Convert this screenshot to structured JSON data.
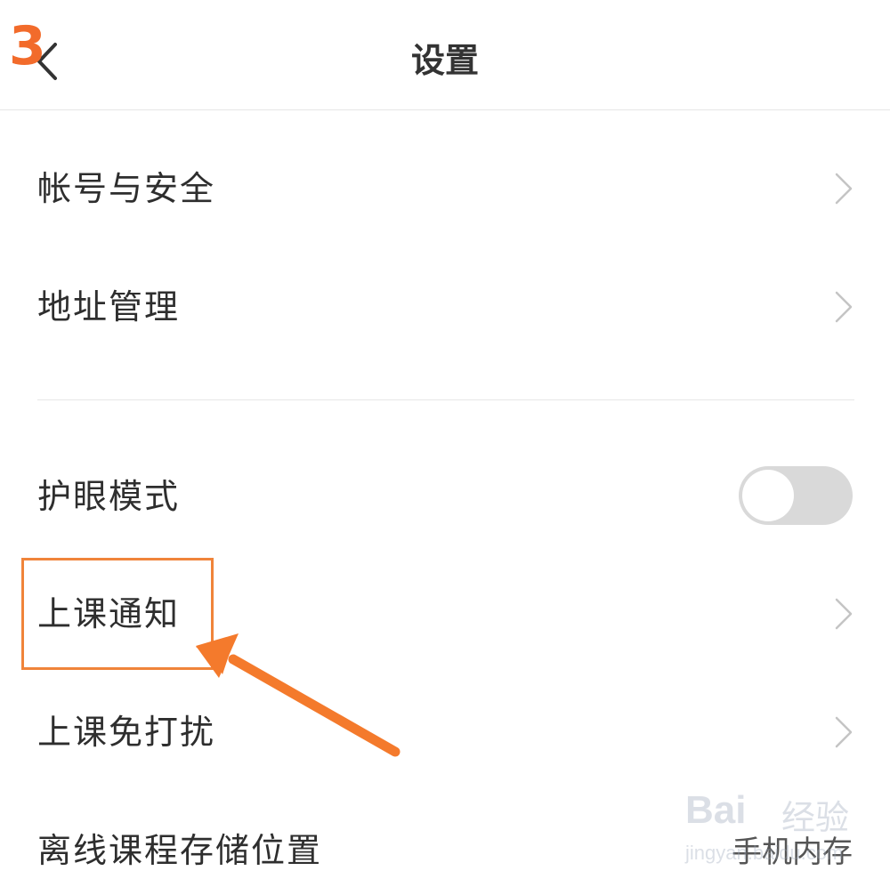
{
  "header": {
    "title": "设置",
    "step_number": "3"
  },
  "settings": {
    "account_security": "帐号与安全",
    "address_management": "地址管理",
    "eye_care_mode": "护眼模式",
    "eye_care_enabled": false,
    "class_notification": "上课通知",
    "class_do_not_disturb": "上课免打扰",
    "offline_storage_location": "离线课程存储位置",
    "offline_storage_value": "手机内存"
  },
  "watermark": {
    "brand": "Bai",
    "cn": "经验",
    "url": "jingyan.baidu.com"
  },
  "colors": {
    "accent": "#f26b2b",
    "highlight": "#f0843a",
    "toggle_off": "#d9d9d9"
  }
}
